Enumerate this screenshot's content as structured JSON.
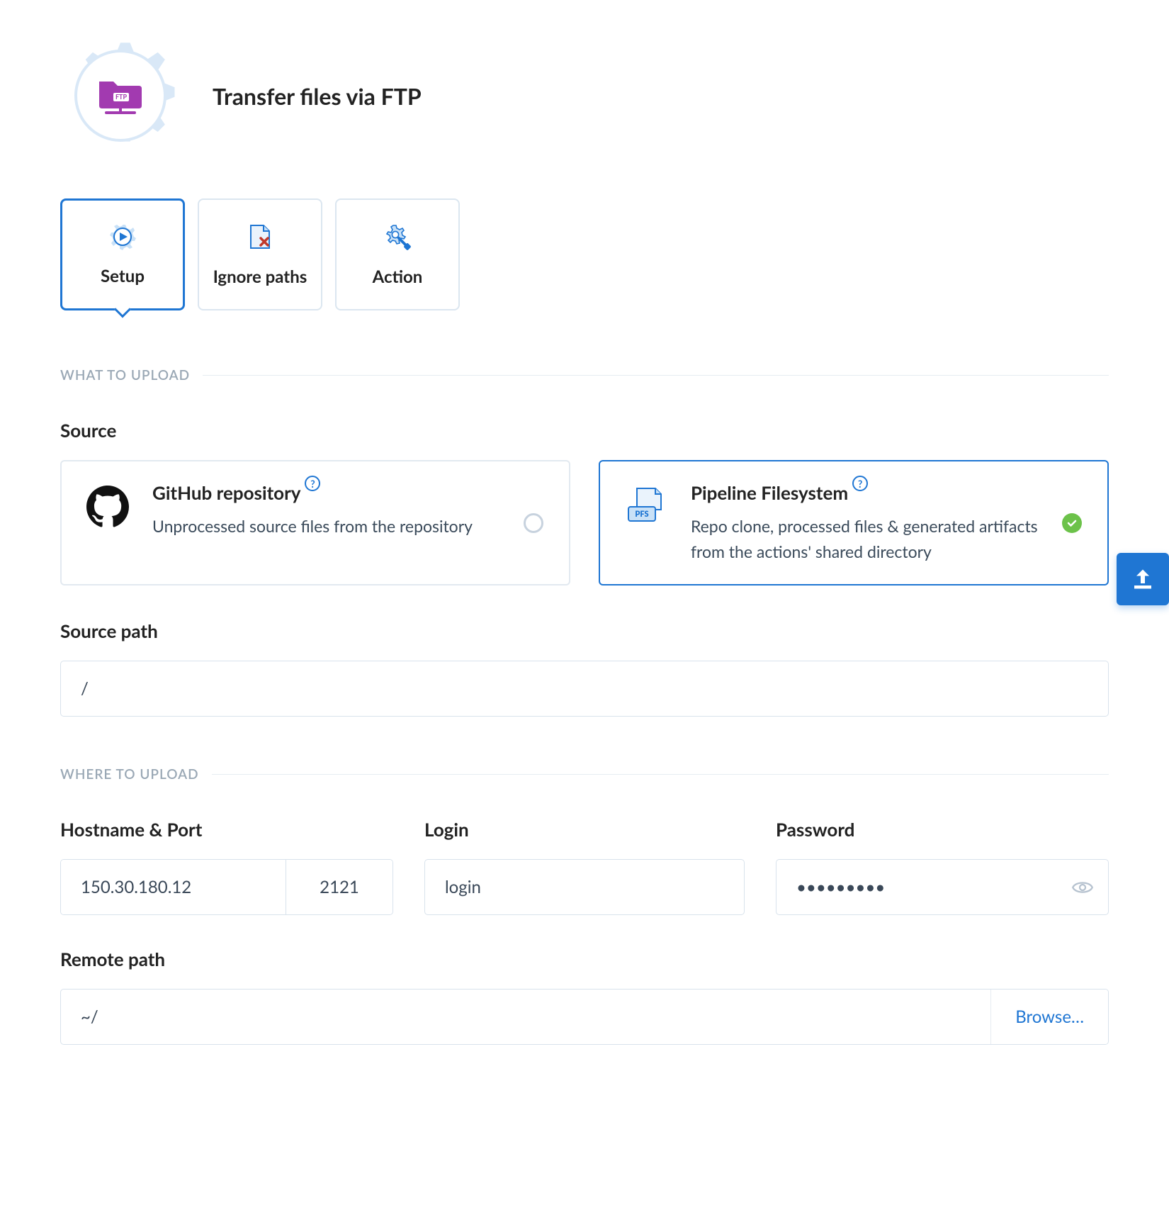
{
  "header": {
    "title": "Transfer files via FTP"
  },
  "tabs": [
    {
      "label": "Setup",
      "active": true
    },
    {
      "label": "Ignore paths",
      "active": false
    },
    {
      "label": "Action",
      "active": false
    }
  ],
  "sections": {
    "what_to_upload": "WHAT TO UPLOAD",
    "where_to_upload": "WHERE TO UPLOAD"
  },
  "source": {
    "label": "Source",
    "options": [
      {
        "title": "GitHub repository",
        "description": "Unprocessed source files from the repository",
        "selected": false
      },
      {
        "title": "Pipeline Filesystem",
        "description": "Repo clone, processed files & generated artifacts from the actions' shared directory",
        "selected": true
      }
    ]
  },
  "source_path": {
    "label": "Source path",
    "value": "/"
  },
  "host": {
    "label": "Hostname & Port",
    "hostname": "150.30.180.12",
    "port": "2121"
  },
  "login": {
    "label": "Login",
    "value": "login"
  },
  "password": {
    "label": "Password",
    "value": "•••••••••"
  },
  "remote_path": {
    "label": "Remote path",
    "value": "~/",
    "browse_label": "Browse…"
  },
  "icons": {
    "help_glyph": "?",
    "float_upload": "upload"
  }
}
